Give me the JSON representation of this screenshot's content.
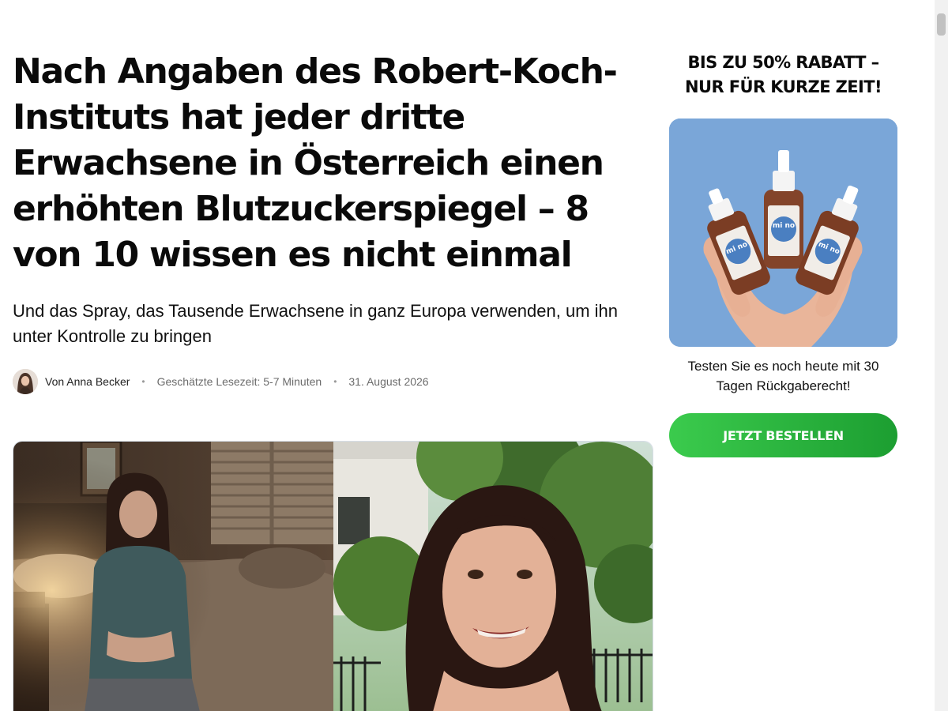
{
  "article": {
    "headline": "Nach Angaben des Robert-Koch-Instituts hat jeder dritte Erwachsene in Österreich einen erhöhten Blutzuckerspiegel – 8 von 10 wissen es nicht einmal",
    "subheadline": "Und das Spray, das Tausende Erwachsene in ganz Europa verwenden, um ihn unter Kontrolle zu bringen",
    "byline": {
      "author": "Von Anna Becker",
      "reading_time": "Geschätzte Lesezeit: 5-7 Minuten",
      "date": "31. August 2026",
      "separator": "•"
    }
  },
  "sidebar": {
    "promo_title": "BIS ZU 50% RABATT – NUR FÜR KURZE ZEIT!",
    "product_brand": "mi no",
    "promo_text": "Testen Sie es noch heute mit 30 Tagen Rückgaberecht!",
    "cta_label": "JETZT BESTELLEN"
  },
  "colors": {
    "cta_gradient_start": "#3bcb4d",
    "cta_gradient_end": "#1c9e31",
    "product_background": "#7aa6d8",
    "text_primary": "#0a0a0a",
    "text_muted": "#6b6b6b"
  }
}
